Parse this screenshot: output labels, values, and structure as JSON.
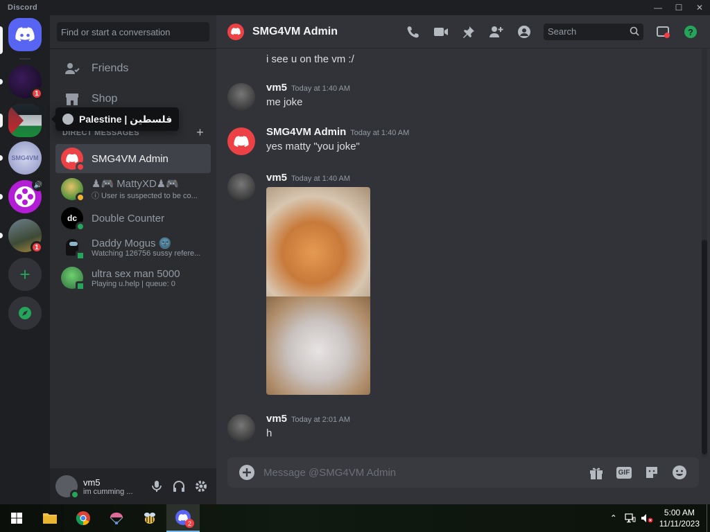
{
  "window": {
    "title": "Discord"
  },
  "tooltip": {
    "text": "Palestine | فلسطين"
  },
  "dm": {
    "search_placeholder": "Find or start a conversation",
    "nav": [
      {
        "label": "Friends"
      },
      {
        "label": "Shop"
      }
    ],
    "section_title": "DIRECT MESSAGES",
    "items": [
      {
        "name": "SMG4VM Admin",
        "sub": ""
      },
      {
        "name": "♟🎮 MattyXD♟🎮",
        "sub": "ⓘ User is suspected to be co..."
      },
      {
        "name": "Double Counter",
        "sub": ""
      },
      {
        "name": "Daddy Mogus 🌚",
        "sub": "Watching 126756 sussy refere..."
      },
      {
        "name": "ultra sex man 5000",
        "sub": "Playing u.help | queue: 0"
      }
    ]
  },
  "user": {
    "name": "vm5",
    "status": "im cumming ..."
  },
  "chat": {
    "title": "SMG4VM Admin",
    "search_placeholder": "Search",
    "composer_placeholder": "Message @SMG4VM Admin",
    "gif_label": "GIF",
    "messages": [
      {
        "author": "",
        "time": "",
        "text": "i see u on the vm :/"
      },
      {
        "author": "vm5",
        "time": "Today at 1:40 AM",
        "text": "me joke"
      },
      {
        "author": "SMG4VM Admin",
        "time": "Today at 1:40 AM",
        "text": "yes matty \"you joke\""
      },
      {
        "author": "vm5",
        "time": "Today at 1:40 AM",
        "text": ""
      },
      {
        "author": "vm5",
        "time": "Today at 2:01 AM",
        "text": "h"
      }
    ]
  },
  "servers": [
    {
      "name": "home",
      "badge": ""
    },
    {
      "name": "server-1",
      "badge": "1"
    },
    {
      "name": "Palestine | فلسطين",
      "badge": ""
    },
    {
      "name": "SMG4VM",
      "badge": ""
    },
    {
      "name": "server-4",
      "badge": ""
    },
    {
      "name": "server-5",
      "badge": "1"
    }
  ],
  "taskbar": {
    "time": "5:00 AM",
    "date": "11/11/2023",
    "discord_badge": "2"
  },
  "colors": {
    "blurple": "#5865f2",
    "online": "#23a55a",
    "dnd": "#f23f43",
    "idle": "#f0b232"
  }
}
